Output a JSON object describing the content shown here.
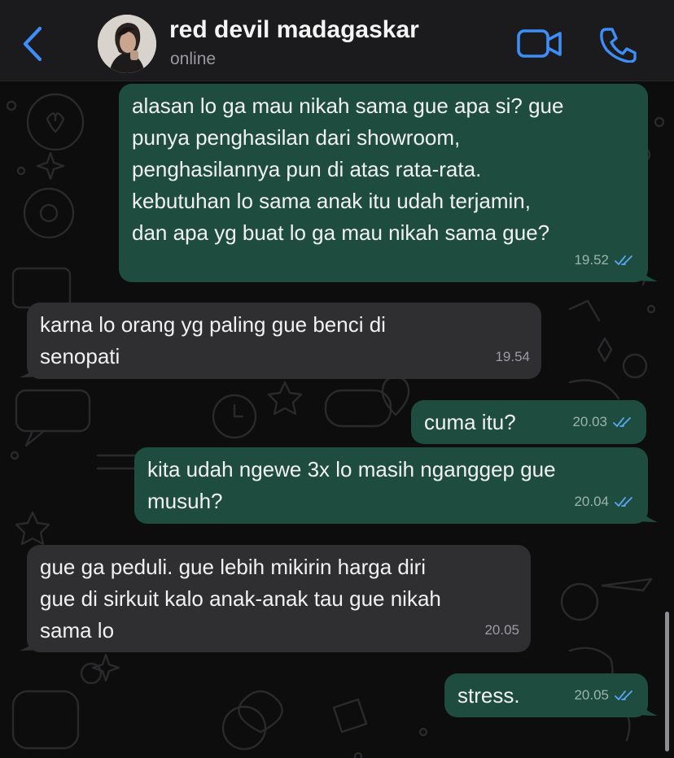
{
  "header": {
    "back_icon": "chevron-left-icon",
    "contact_name": "red devil madagaskar",
    "status": "online",
    "video_icon": "video-camera-icon",
    "call_icon": "phone-icon",
    "accent_color": "#3d8ef7"
  },
  "messages": [
    {
      "direction": "out",
      "text": "alasan lo ga mau nikah sama gue apa si? gue\npunya penghasilan dari showroom,\npenghasilannya pun di atas rata-rata.\nkebutuhan lo sama anak itu udah terjamin,\ndan apa yg buat lo ga mau nikah sama gue?",
      "time": "19.52",
      "read": true
    },
    {
      "direction": "in",
      "text": "karna lo orang yg paling gue benci di\nsenopati",
      "time": "19.54"
    },
    {
      "direction": "out",
      "text": "cuma itu?",
      "time": "20.03",
      "read": true
    },
    {
      "direction": "out",
      "text": "kita udah ngewe 3x lo masih nganggep gue\nmusuh?",
      "time": "20.04",
      "read": true
    },
    {
      "direction": "in",
      "text": "gue ga peduli. gue lebih mikirin harga diri\ngue di sirkuit kalo anak-anak tau gue nikah\nsama lo",
      "time": "20.05"
    },
    {
      "direction": "out",
      "text": "stress.",
      "time": "20.05",
      "read": true
    }
  ],
  "colors": {
    "outgoing_bubble": "#1e4d3f",
    "incoming_bubble": "#2f2f32",
    "read_ticks": "#5aa7f5"
  }
}
